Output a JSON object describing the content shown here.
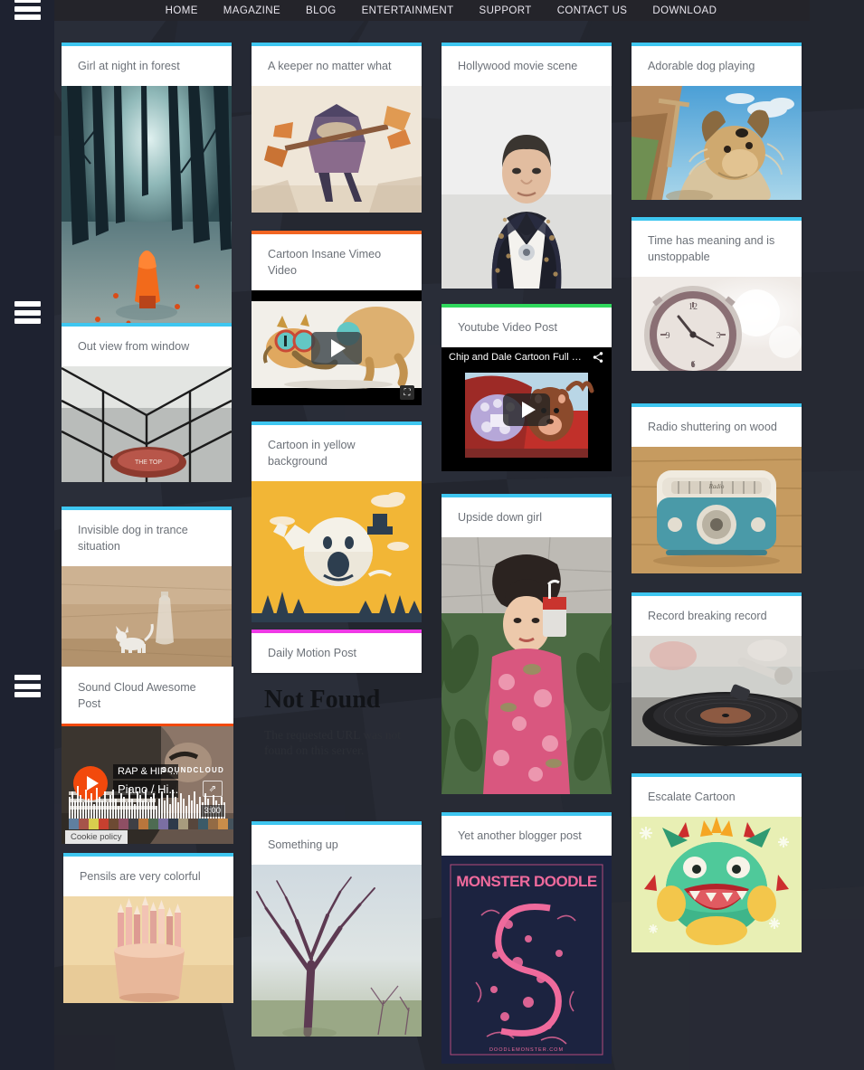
{
  "nav": {
    "items": [
      {
        "label": "HOME"
      },
      {
        "label": "MAGAZINE"
      },
      {
        "label": "BLOG"
      },
      {
        "label": "ENTERTAINMENT"
      },
      {
        "label": "SUPPORT"
      },
      {
        "label": "CONTACT US"
      },
      {
        "label": "DOWNLOAD"
      }
    ]
  },
  "colors": {
    "accent_cyan": "#3ec6f0",
    "accent_orange": "#f26522",
    "accent_green": "#2fd85c",
    "accent_pink": "#ef3ae6",
    "rail": "#1e2230",
    "topbar": "#24242a",
    "title_text": "#6c7178"
  },
  "sidebar": {
    "menu_icons": [
      {
        "name": "hamburger-menu-1"
      },
      {
        "name": "hamburger-menu-2"
      },
      {
        "name": "hamburger-menu-3"
      }
    ]
  },
  "cards": {
    "girl_forest": {
      "title": "Girl at night in forest"
    },
    "keeper": {
      "title": "A keeper no matter what"
    },
    "hollywood": {
      "title": "Hollywood movie scene"
    },
    "dog": {
      "title": "Adorable dog playing"
    },
    "time": {
      "title": "Time has meaning and is unstoppable"
    },
    "vimeo": {
      "title": "Cartoon Insane Vimeo Video"
    },
    "youtube": {
      "title": "Youtube Video Post",
      "video_title": "Chip and Dale Cartoon Full Episodes...",
      "share_icon": "share-icon"
    },
    "window": {
      "title": "Out view from window"
    },
    "radio": {
      "title": "Radio shuttering on wood"
    },
    "cartoon_yellow": {
      "title": "Cartoon in yellow background"
    },
    "invisible_dog": {
      "title": "Invisible dog in trance situation"
    },
    "upside_girl": {
      "title": "Upside down girl"
    },
    "record": {
      "title": "Record breaking record"
    },
    "dailymotion": {
      "title": "Daily Motion Post",
      "error_title": "Not Found",
      "error_body": "The requested URL was not found on this server."
    },
    "soundcloud": {
      "title": "Sound Cloud Awesome Post",
      "track_line1": "RAP & HIP-...",
      "track_line2": "Piano / Hi...",
      "brand": "SOUNDCLOUD",
      "duration": "3:00",
      "cookie_notice": "Cookie policy",
      "share_icon": "share-export-icon",
      "play_icon": "play-icon"
    },
    "escalate": {
      "title": "Escalate Cartoon"
    },
    "pencils": {
      "title": "Pensils are very colorful"
    },
    "something_up": {
      "title": "Something up"
    },
    "blogger": {
      "title": "Yet another blogger post"
    }
  }
}
